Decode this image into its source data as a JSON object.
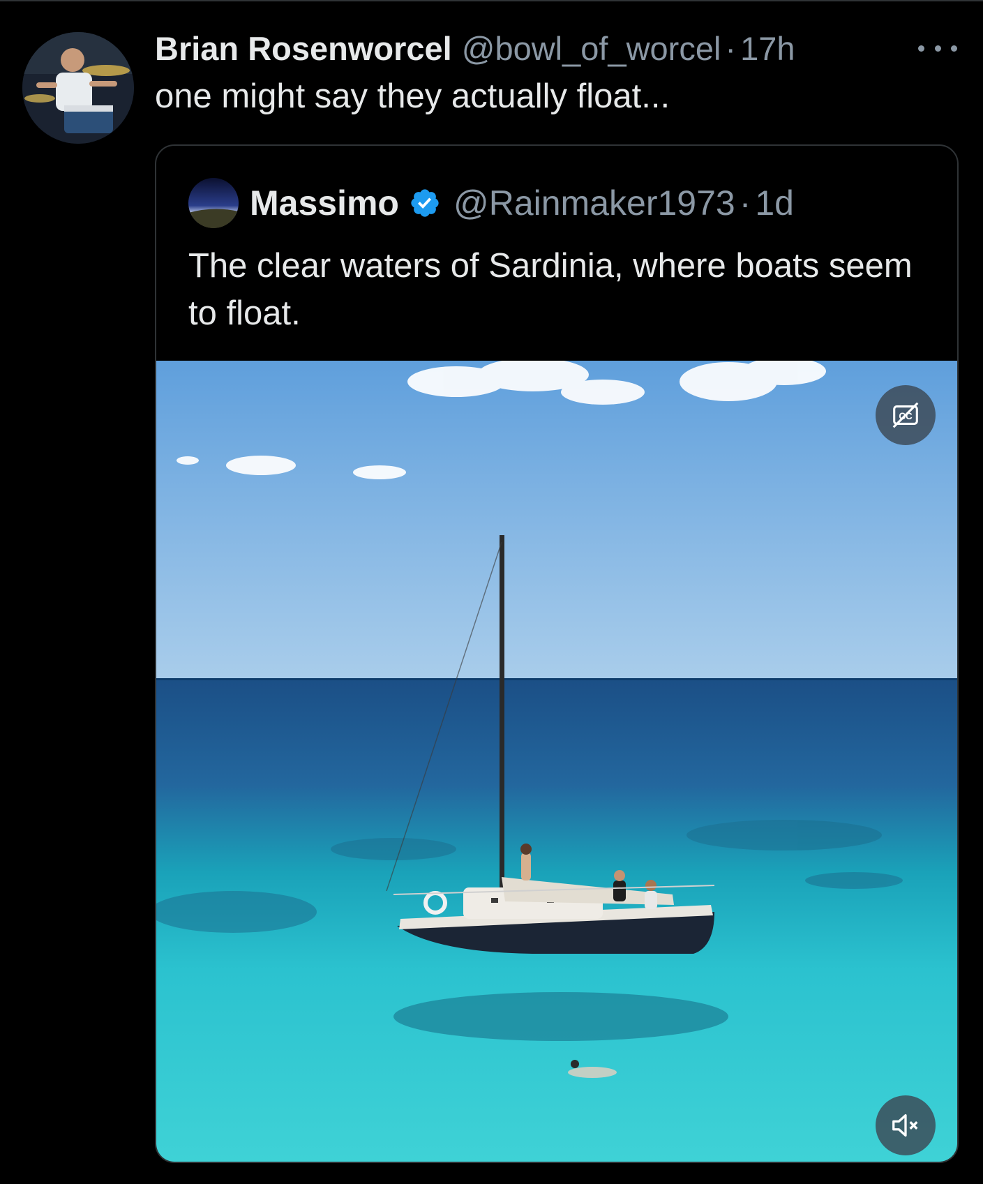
{
  "post": {
    "author": {
      "display_name": "Brian Rosenworcel",
      "handle": "@bowl_of_worcel",
      "separator": "·",
      "time": "17h",
      "avatar_icon": "avatar-drummer-photo"
    },
    "text": "one might say they actually float...",
    "more_icon": "more-horizontal-icon"
  },
  "quoted_post": {
    "author": {
      "display_name": "Massimo",
      "verified": true,
      "handle": "@Rainmaker1973",
      "separator": "·",
      "time": "1d",
      "avatar_icon": "avatar-night-sky-photo"
    },
    "text": "The clear waters of Sardinia, where boats seem to float.",
    "media": {
      "type": "video",
      "captions_icon": "closed-captions-off-icon",
      "mute_icon": "volume-muted-icon"
    }
  },
  "colors": {
    "background": "#000000",
    "primary_text": "#e7e9ea",
    "secondary_text": "#8b98a5",
    "border": "#2f3336",
    "verified_badge": "#1d9bf0"
  }
}
